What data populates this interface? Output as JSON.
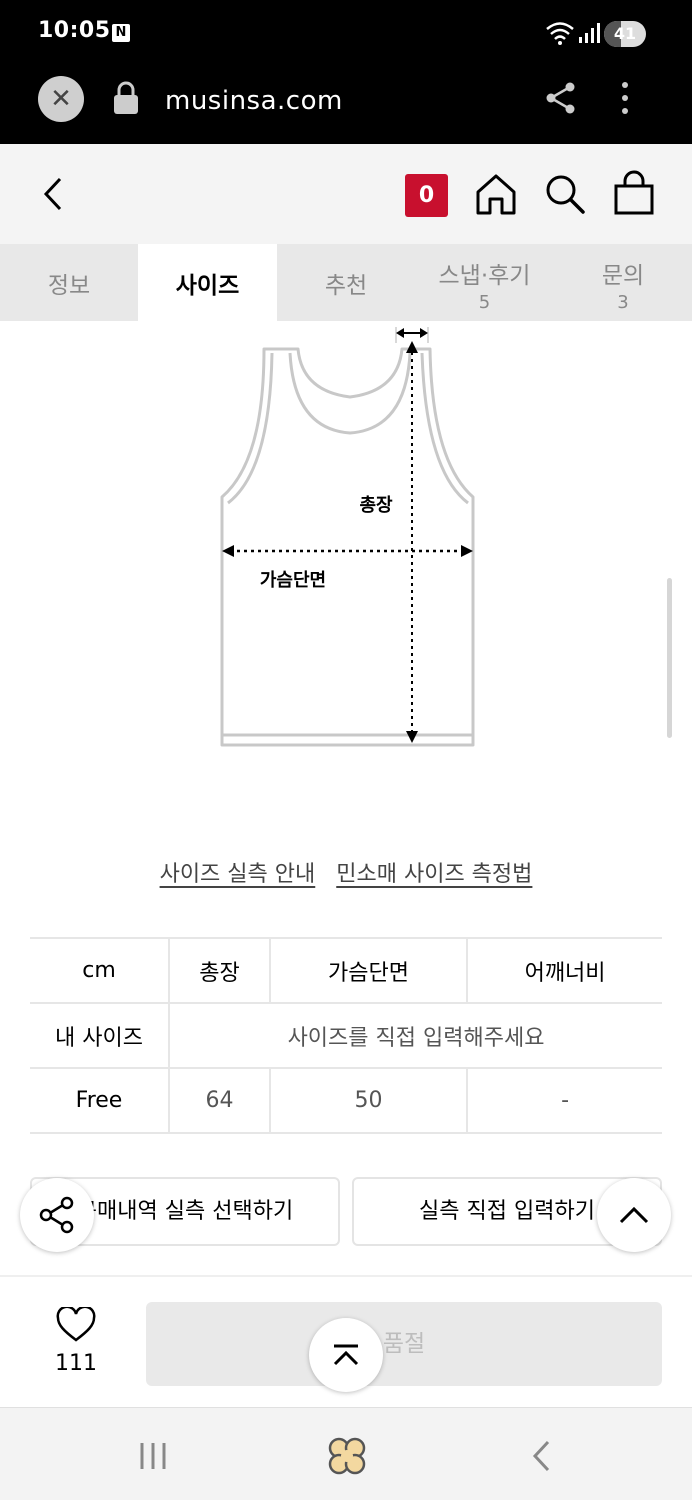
{
  "status_bar": {
    "time": "10:05",
    "notification_badge": "N",
    "battery_level": "41"
  },
  "browser": {
    "url": "musinsa.com"
  },
  "header": {
    "cart_count": "0"
  },
  "tabs": [
    {
      "label": "정보",
      "count": ""
    },
    {
      "label": "사이즈",
      "count": ""
    },
    {
      "label": "추천",
      "count": ""
    },
    {
      "label": "스냅·후기",
      "count": "5"
    },
    {
      "label": "문의",
      "count": "3"
    }
  ],
  "diagram": {
    "length_label": "총장",
    "chest_label": "가슴단면"
  },
  "links": {
    "size_guide": "사이즈 실측 안내",
    "measure_method": "민소매 사이즈 측정법"
  },
  "size_table": {
    "headers": [
      "cm",
      "총장",
      "가슴단면",
      "어깨너비"
    ],
    "my_size_label": "내 사이즈",
    "my_size_prompt": "사이즈를 직접 입력해주세요",
    "rows": [
      {
        "size": "Free",
        "values": [
          "64",
          "50",
          "-"
        ]
      }
    ]
  },
  "actions": {
    "purchase_history_button": "구매내역 실측 선택하기",
    "manual_input_button": "실측 직접 입력하기"
  },
  "footer": {
    "like_count": "111",
    "buy_label": "품절"
  },
  "colors": {
    "brand_red": "#c8102e",
    "text_gray": "#888888"
  }
}
